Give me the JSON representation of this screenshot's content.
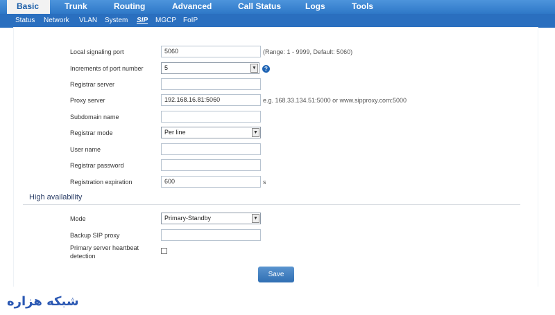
{
  "nav": {
    "tabs": [
      "Basic",
      "Trunk",
      "Routing",
      "Advanced",
      "Call Status",
      "Logs",
      "Tools"
    ],
    "active_tab": "Basic"
  },
  "subnav": {
    "items": [
      "Status",
      "Network",
      "VLAN",
      "System",
      "SIP",
      "MGCP",
      "FoIP"
    ],
    "active_item": "SIP"
  },
  "form": {
    "local_signaling_port": {
      "label": "Local signaling port",
      "value": "5060",
      "hint": "(Range: 1 - 9999, Default: 5060)"
    },
    "increments_port_number": {
      "label": "Increments of port number",
      "value": "5"
    },
    "registrar_server": {
      "label": "Registrar server",
      "value": ""
    },
    "proxy_server": {
      "label": "Proxy server",
      "value": "192.168.16.81:5060",
      "hint": "e.g. 168.33.134.51:5000 or www.sipproxy.com:5000"
    },
    "subdomain_name": {
      "label": "Subdomain name",
      "value": ""
    },
    "registrar_mode": {
      "label": "Registrar mode",
      "value": "Per line"
    },
    "user_name": {
      "label": "User name",
      "value": ""
    },
    "registrar_password": {
      "label": "Registrar password",
      "value": ""
    },
    "registration_expiration": {
      "label": "Registration expiration",
      "value": "600",
      "unit": "s"
    }
  },
  "high_availability": {
    "title": "High availability",
    "mode": {
      "label": "Mode",
      "value": "Primary-Standby"
    },
    "backup_sip_proxy": {
      "label": "Backup SIP proxy",
      "value": ""
    },
    "heartbeat": {
      "label_line1": "Primary server heartbeat",
      "label_line2": "detection",
      "checked": false
    }
  },
  "buttons": {
    "save": "Save"
  },
  "icons": {
    "help": "?",
    "select_arrow": "▼"
  },
  "watermark": "شبکه هزاره",
  "colors": {
    "nav_blue": "#2e78c7",
    "subnav_blue": "#2a6fbf",
    "active_tab_text": "#1b5ea8"
  }
}
